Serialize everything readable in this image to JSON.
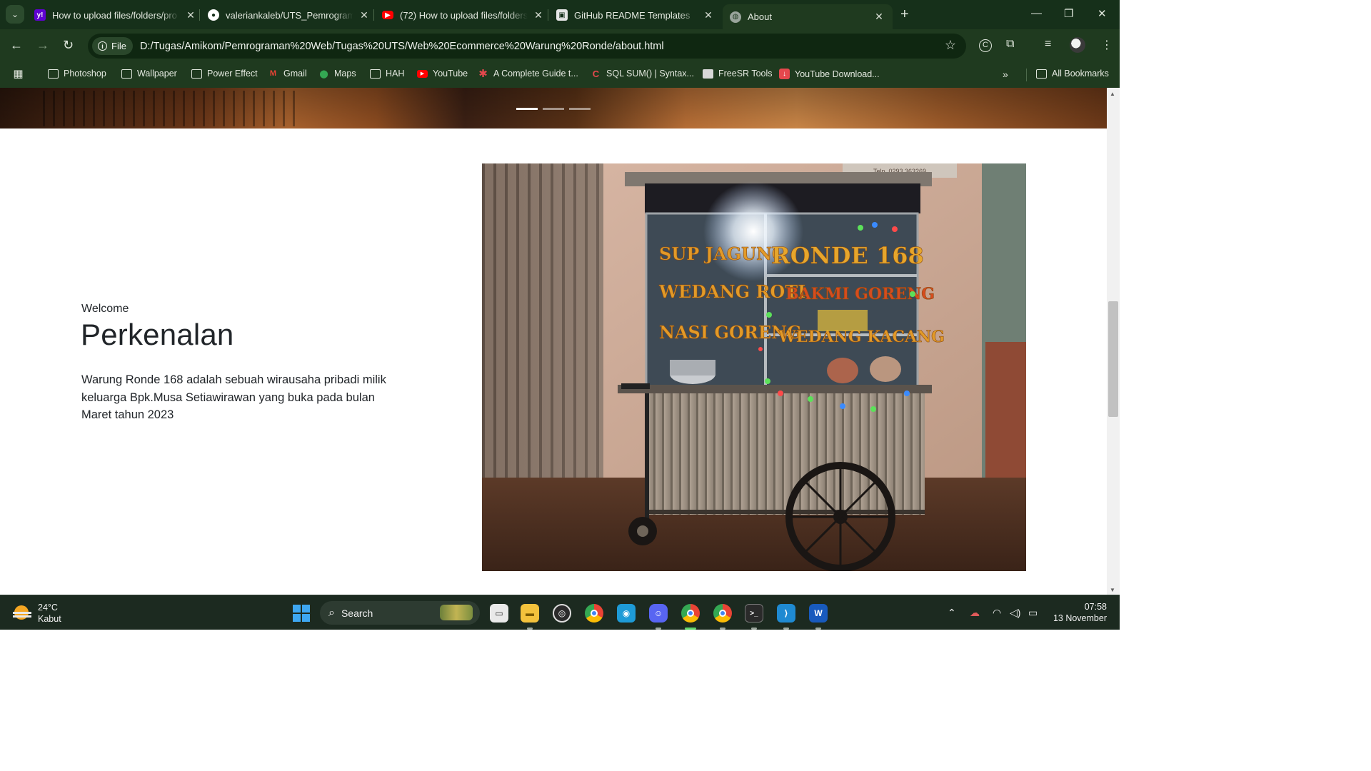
{
  "browser": {
    "tabs": [
      {
        "title": "How to upload files/folders/pro",
        "favicon": "yahoo-icon",
        "color": "#6001d2",
        "active": false
      },
      {
        "title": "valeriankaleb/UTS_Pemrograma",
        "favicon": "github-icon",
        "color": "#ffffff",
        "active": false
      },
      {
        "title": "(72) How to upload files/folders",
        "favicon": "youtube-icon",
        "color": "#ff0000",
        "active": false
      },
      {
        "title": "GitHub README Templates",
        "favicon": "readme-templates-icon",
        "color": "#e6e6e6",
        "active": false
      },
      {
        "title": "About",
        "favicon": "globe-icon",
        "color": "#9aa59c",
        "active": true
      }
    ],
    "address": {
      "scheme_label": "File",
      "url": "D:/Tugas/Amikom/Pemrograman%20Web/Tugas%20UTS/Web%20Ecommerce%20Warung%20Ronde/about.html"
    },
    "bookmarks": [
      {
        "label": "Photoshop",
        "icon": "folder-icon"
      },
      {
        "label": "Wallpaper",
        "icon": "folder-icon"
      },
      {
        "label": "Power Effect",
        "icon": "folder-icon"
      },
      {
        "label": "Gmail",
        "icon": "gmail-icon"
      },
      {
        "label": "Maps",
        "icon": "maps-icon"
      },
      {
        "label": "HAH",
        "icon": "folder-icon"
      },
      {
        "label": "YouTube",
        "icon": "youtube-icon"
      },
      {
        "label": "A Complete Guide t...",
        "icon": "asterisk-icon"
      },
      {
        "label": "SQL SUM() | Syntax...",
        "icon": "sql-icon"
      },
      {
        "label": "FreeSR Tools",
        "icon": "freesr-icon"
      },
      {
        "label": "YouTube Download...",
        "icon": "download-icon"
      }
    ],
    "all_bookmarks_label": "All Bookmarks"
  },
  "page": {
    "carousel": {
      "slide_count": 3,
      "active_index": 0
    },
    "about": {
      "eyebrow": "Welcome",
      "heading": "Perkenalan",
      "body": "Warung Ronde 168 adalah sebuah wirausaha pribadi milik keluarga Bpk.Musa Setiawirawan yang buka pada bulan Maret tahun 2023"
    },
    "photo": {
      "sign_top": "Telp. 0293 363269",
      "left_panel": [
        "SUP JAGUNG",
        "WEDANG ROTI",
        "NASI GORENG"
      ],
      "right_panel": [
        "RONDE 168",
        "BAKMI GORENG",
        "WEDANG KACANG"
      ]
    }
  },
  "taskbar": {
    "weather": {
      "temp": "24°C",
      "condition": "Kabut"
    },
    "search_label": "Search",
    "time": "07:58",
    "date": "13 November",
    "apps": [
      "file-explorer",
      "task-view",
      "obs",
      "chrome",
      "teams",
      "discord",
      "chrome-active",
      "chrome-profile",
      "terminal",
      "vscode",
      "word"
    ]
  }
}
